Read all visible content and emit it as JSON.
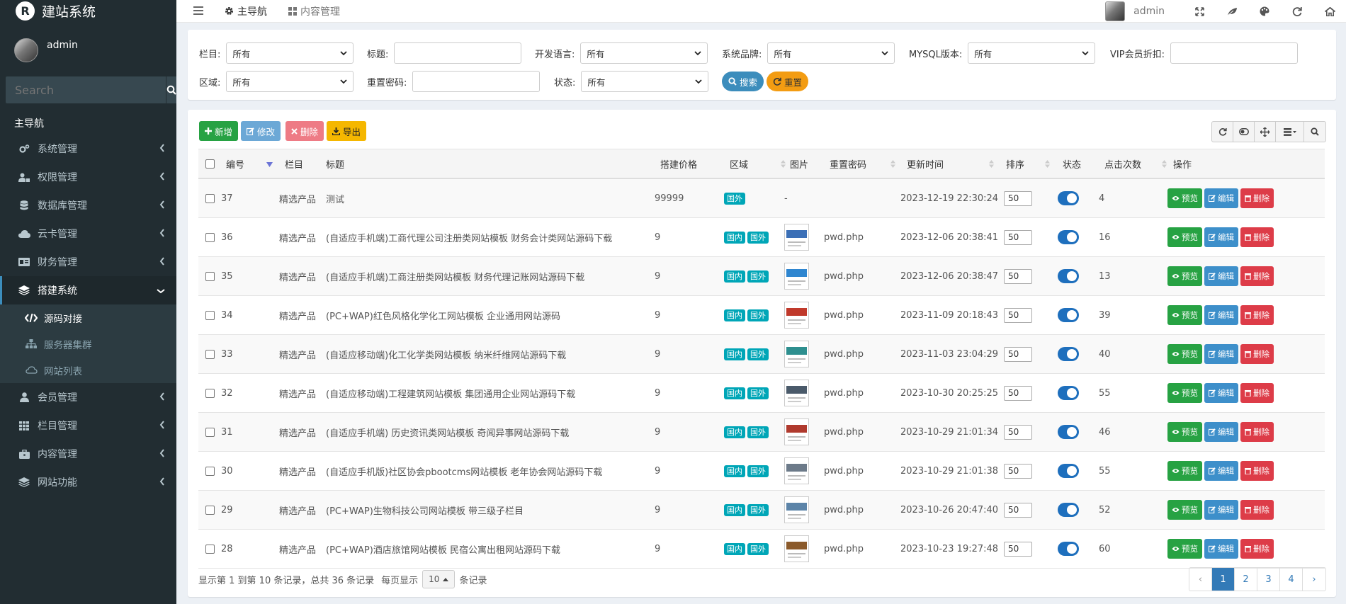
{
  "app": {
    "logo_glyph": "R",
    "title": "建站系统"
  },
  "user": {
    "name": "admin"
  },
  "sidebar": {
    "search_placeholder": "Search",
    "header": "主导航",
    "items": [
      {
        "label": "系统管理",
        "icon": "cogs-icon"
      },
      {
        "label": "权限管理",
        "icon": "user-lock-icon"
      },
      {
        "label": "数据库管理",
        "icon": "database-icon"
      },
      {
        "label": "云卡管理",
        "icon": "cloud-icon"
      },
      {
        "label": "财务管理",
        "icon": "finance-icon"
      },
      {
        "label": "搭建系统",
        "icon": "layers-icon",
        "expanded": true
      },
      {
        "label": "会员管理",
        "icon": "user-icon"
      },
      {
        "label": "栏目管理",
        "icon": "grid-icon"
      },
      {
        "label": "内容管理",
        "icon": "briefcase-icon"
      },
      {
        "label": "网站功能",
        "icon": "stack-icon"
      }
    ],
    "subitems": [
      {
        "label": "源码对接",
        "icon": "code-icon",
        "active": true
      },
      {
        "label": "服务器集群",
        "icon": "sitemap-icon"
      },
      {
        "label": "网站列表",
        "icon": "cloud-outline-icon"
      }
    ]
  },
  "topbar": {
    "tabs": [
      {
        "label": "主导航",
        "icon": "gear-icon"
      },
      {
        "label": "内容管理",
        "icon": "grid-icon"
      }
    ],
    "user": "admin",
    "icons": [
      "fullscreen-icon",
      "leaf-icon",
      "palette-icon",
      "refresh-icon",
      "home-icon"
    ]
  },
  "filters": {
    "row1": [
      {
        "label": "栏目:",
        "value": "所有",
        "type": "select"
      },
      {
        "label": "标题:",
        "value": "",
        "type": "input"
      },
      {
        "label": "开发语言:",
        "value": "所有",
        "type": "select"
      },
      {
        "label": "系统品牌:",
        "value": "所有",
        "type": "select"
      },
      {
        "label": "MYSQL版本:",
        "value": "所有",
        "type": "select"
      },
      {
        "label": "VIP会员折扣:",
        "value": "",
        "type": "input"
      }
    ],
    "row2": [
      {
        "label": "区域:",
        "value": "所有",
        "type": "select"
      },
      {
        "label": "重置密码:",
        "value": "",
        "type": "input"
      },
      {
        "label": "状态:",
        "value": "所有",
        "type": "select"
      }
    ],
    "search_label": "搜索",
    "reset_label": "重置"
  },
  "toolbar": {
    "add": "新增",
    "edit": "修改",
    "delete": "删除",
    "export": "导出"
  },
  "table": {
    "headers": {
      "id": "编号",
      "column": "栏目",
      "title": "标题",
      "price": "搭建价格",
      "region": "区域",
      "image": "图片",
      "password": "重置密码",
      "updated": "更新时间",
      "order": "排序",
      "status": "状态",
      "clicks": "点击次数",
      "actions": "操作"
    },
    "action_labels": {
      "preview": "预览",
      "edit": "编辑",
      "delete": "删除"
    },
    "rows": [
      {
        "id": "37",
        "column": "精选产品",
        "title": "测试",
        "price": "99999",
        "regions": [
          "国外"
        ],
        "image": "-",
        "password": "",
        "updated": "2023-12-19 22:30:24",
        "order": "50",
        "clicks": "4"
      },
      {
        "id": "36",
        "column": "精选产品",
        "title": "(自适应手机端)工商代理公司注册类网站模板 财务会计类网站源码下载",
        "price": "9",
        "regions": [
          "国内",
          "国外"
        ],
        "image": "thumb",
        "password": "pwd.php",
        "updated": "2023-12-06 20:38:41",
        "order": "50",
        "clicks": "16"
      },
      {
        "id": "35",
        "column": "精选产品",
        "title": "(自适应手机端)工商注册类网站模板 财务代理记账网站源码下载",
        "price": "9",
        "regions": [
          "国内",
          "国外"
        ],
        "image": "thumb",
        "password": "pwd.php",
        "updated": "2023-12-06 20:38:47",
        "order": "50",
        "clicks": "13"
      },
      {
        "id": "34",
        "column": "精选产品",
        "title": "(PC+WAP)红色风格化学化工网站模板 企业通用网站源码",
        "price": "9",
        "regions": [
          "国内",
          "国外"
        ],
        "image": "thumb",
        "password": "pwd.php",
        "updated": "2023-11-09 20:18:43",
        "order": "50",
        "clicks": "39"
      },
      {
        "id": "33",
        "column": "精选产品",
        "title": "(自适应移动端)化工化学类网站模板 纳米纤维网站源码下载",
        "price": "9",
        "regions": [
          "国内",
          "国外"
        ],
        "image": "thumb",
        "password": "pwd.php",
        "updated": "2023-11-03 23:04:29",
        "order": "50",
        "clicks": "40"
      },
      {
        "id": "32",
        "column": "精选产品",
        "title": "(自适应移动端)工程建筑网站模板 集团通用企业网站源码下载",
        "price": "9",
        "regions": [
          "国内",
          "国外"
        ],
        "image": "thumb",
        "password": "pwd.php",
        "updated": "2023-10-30 20:25:25",
        "order": "50",
        "clicks": "55"
      },
      {
        "id": "31",
        "column": "精选产品",
        "title": "(自适应手机端) 历史资讯类网站模板 奇闻异事网站源码下载",
        "price": "9",
        "regions": [
          "国内",
          "国外"
        ],
        "image": "thumb",
        "password": "pwd.php",
        "updated": "2023-10-29 21:01:34",
        "order": "50",
        "clicks": "46"
      },
      {
        "id": "30",
        "column": "精选产品",
        "title": "(自适应手机版)社区协会pbootcms网站模板 老年协会网站源码下载",
        "price": "9",
        "regions": [
          "国内",
          "国外"
        ],
        "image": "thumb",
        "password": "pwd.php",
        "updated": "2023-10-29 21:01:38",
        "order": "50",
        "clicks": "55"
      },
      {
        "id": "29",
        "column": "精选产品",
        "title": "(PC+WAP)生物科技公司网站模板 带三级子栏目",
        "price": "9",
        "regions": [
          "国内",
          "国外"
        ],
        "image": "thumb",
        "password": "pwd.php",
        "updated": "2023-10-26 20:47:40",
        "order": "50",
        "clicks": "52"
      },
      {
        "id": "28",
        "column": "精选产品",
        "title": "(PC+WAP)酒店旅馆网站模板 民宿公寓出租网站源码下载",
        "price": "9",
        "regions": [
          "国内",
          "国外"
        ],
        "image": "thumb",
        "password": "pwd.php",
        "updated": "2023-10-23 19:27:48",
        "order": "50",
        "clicks": "60"
      }
    ]
  },
  "footer": {
    "summary": "显示第 1 到第 10 条记录，总共 36 条记录",
    "per_page_prefix": "每页显示",
    "per_page": "10",
    "per_page_suffix": "条记录"
  },
  "pagination": {
    "prev": "‹",
    "pages": [
      "1",
      "2",
      "3",
      "4"
    ],
    "next": "›",
    "current": "1"
  },
  "colors": {
    "sidebar": "#222d32",
    "primary": "#3c8dbc",
    "success": "#27a243",
    "danger": "#dd3c48",
    "warning": "#f39c12",
    "badge": "#00a6b7"
  }
}
